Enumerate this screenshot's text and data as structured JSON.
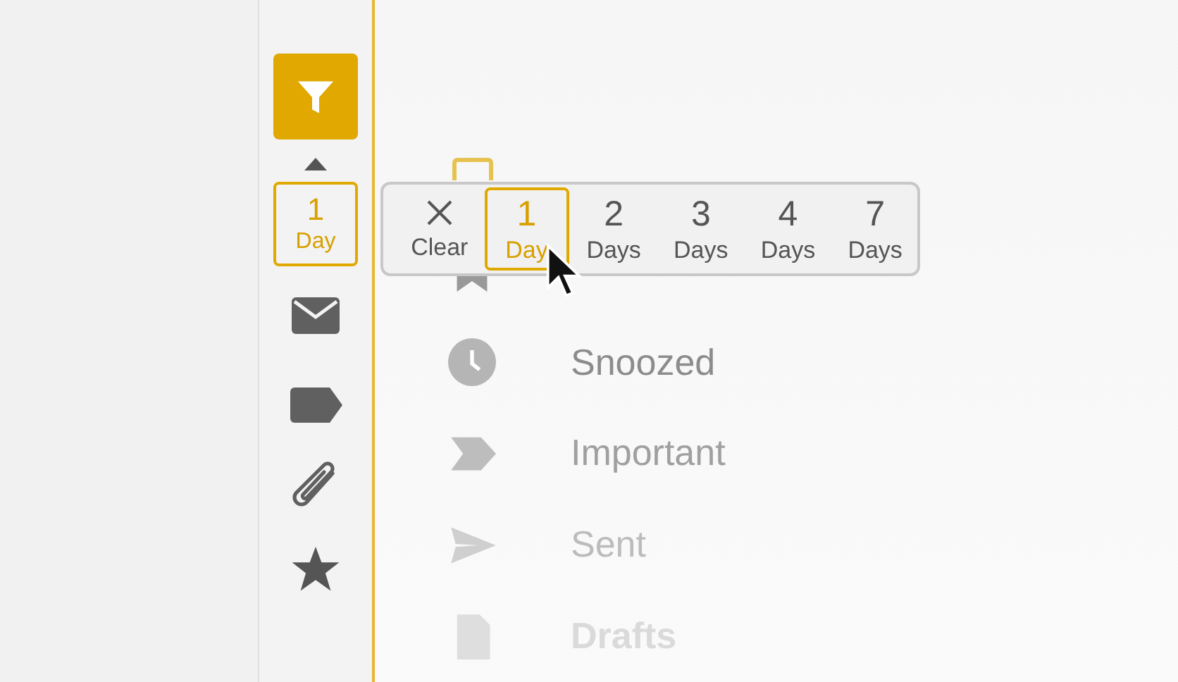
{
  "sidebar": {
    "filter_chip": {
      "number": "1",
      "unit": "Day"
    }
  },
  "folders": [
    {
      "kind": "inbox"
    },
    {
      "kind": "starred"
    },
    {
      "kind": "snoozed",
      "label": "Snoozed"
    },
    {
      "kind": "important",
      "label": "Important"
    },
    {
      "kind": "sent",
      "label": "Sent"
    },
    {
      "kind": "drafts",
      "label": "Drafts"
    }
  ],
  "date_popup": {
    "options": [
      {
        "kind": "clear",
        "label": "Clear",
        "selected": false
      },
      {
        "kind": "days",
        "number": "1",
        "unit": "Day",
        "selected": true
      },
      {
        "kind": "days",
        "number": "2",
        "unit": "Days",
        "selected": false
      },
      {
        "kind": "days",
        "number": "3",
        "unit": "Days",
        "selected": false
      },
      {
        "kind": "days",
        "number": "4",
        "unit": "Days",
        "selected": false
      },
      {
        "kind": "days",
        "number": "7",
        "unit": "Days",
        "selected": false
      }
    ]
  }
}
